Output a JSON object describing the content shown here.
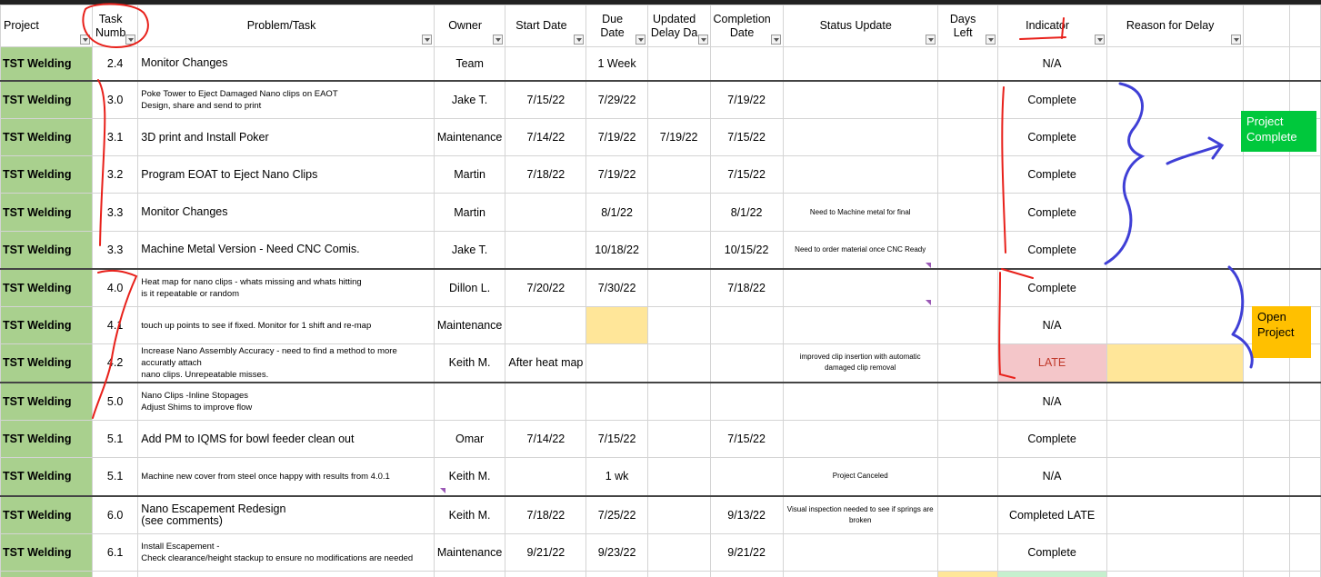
{
  "columns": {
    "project": "Project",
    "task": "Task Numb",
    "problem": "Problem/Task",
    "owner": "Owner",
    "start": "Start Date",
    "due": "Due Date",
    "updated": "Updated Delay Da",
    "completion": "Completion Date",
    "status": "Status Update",
    "days": "Days Left",
    "indicator": "Indicator",
    "reason": "Reason for Delay"
  },
  "rows": [
    {
      "project": "TST Welding",
      "task": "2.4",
      "problem": "Monitor Changes",
      "owner": "Team",
      "start": "",
      "due": "1 Week",
      "updated": "",
      "completion": "",
      "status": "",
      "days": "",
      "indicator": "N/A",
      "reason": ""
    },
    {
      "project": "TST Welding",
      "task": "3.0",
      "problem": "Poke Tower to Eject Damaged Nano clips on EAOT\nDesign, share and send to print",
      "owner": "Jake T.",
      "start": "7/15/22",
      "due": "7/29/22",
      "updated": "",
      "completion": "7/19/22",
      "status": "",
      "days": "",
      "indicator": "Complete",
      "reason": ""
    },
    {
      "project": "TST Welding",
      "task": "3.1",
      "problem": "3D print and Install Poker",
      "owner": "Maintenance",
      "start": "7/14/22",
      "due": "7/19/22",
      "updated": "7/19/22",
      "completion": "7/15/22",
      "status": "",
      "days": "",
      "indicator": "Complete",
      "reason": ""
    },
    {
      "project": "TST Welding",
      "task": "3.2",
      "problem": "Program EOAT to Eject Nano Clips",
      "owner": "Martin",
      "start": "7/18/22",
      "due": "7/19/22",
      "updated": "",
      "completion": "7/15/22",
      "status": "",
      "days": "",
      "indicator": "Complete",
      "reason": ""
    },
    {
      "project": "TST Welding",
      "task": "3.3",
      "problem": "Monitor Changes",
      "owner": "Martin",
      "start": "",
      "due": "8/1/22",
      "updated": "",
      "completion": "8/1/22",
      "status": "Need to Machine metal for final",
      "days": "",
      "indicator": "Complete",
      "reason": ""
    },
    {
      "project": "TST Welding",
      "task": "3.3",
      "problem": "Machine Metal Version - Need CNC Comis.",
      "owner": "Jake T.",
      "start": "",
      "due": "10/18/22",
      "updated": "",
      "completion": "10/15/22",
      "status": "Need to order material once CNC Ready",
      "days": "",
      "indicator": "Complete",
      "reason": ""
    },
    {
      "project": "TST Welding",
      "task": "4.0",
      "problem": "Heat map for nano clips - whats missing and whats hitting\nis it repeatable or random",
      "owner": "Dillon L.",
      "start": "7/20/22",
      "due": "7/30/22",
      "updated": "",
      "completion": "7/18/22",
      "status": "",
      "days": "",
      "indicator": "Complete",
      "reason": ""
    },
    {
      "project": "TST Welding",
      "task": "4.1",
      "problem": "touch up points to see if fixed. Monitor for 1 shift and re-map",
      "owner": "Maintenance",
      "start": "",
      "due": "",
      "updated": "",
      "completion": "",
      "status": "",
      "days": "",
      "indicator": "N/A",
      "reason": ""
    },
    {
      "project": "TST Welding",
      "task": "4.2",
      "problem": "Increase Nano Assembly Accuracy - need to find a method to more accuratly attach\nnano clips. Unrepeatable misses.",
      "owner": "Keith M.",
      "start": "After heat map",
      "due": "",
      "updated": "",
      "completion": "",
      "status": "improved clip insertion with automatic damaged clip removal",
      "days": "",
      "indicator": "LATE",
      "reason": ""
    },
    {
      "project": "TST Welding",
      "task": "5.0",
      "problem": "Nano Clips -Inline Stopages\nAdjust Shims to improve flow",
      "owner": "",
      "start": "",
      "due": "",
      "updated": "",
      "completion": "",
      "status": "",
      "days": "",
      "indicator": "N/A",
      "reason": ""
    },
    {
      "project": "TST Welding",
      "task": "5.1",
      "problem": "Add PM to IQMS for bowl feeder clean out",
      "owner": "Omar",
      "start": "7/14/22",
      "due": "7/15/22",
      "updated": "",
      "completion": "7/15/22",
      "status": "",
      "days": "",
      "indicator": "Complete",
      "reason": ""
    },
    {
      "project": "TST Welding",
      "task": "5.1",
      "problem": "Machine new cover from steel once happy with results from 4.0.1",
      "owner": "Keith M.",
      "start": "",
      "due": "1 wk",
      "updated": "",
      "completion": "",
      "status": "Project Canceled",
      "days": "",
      "indicator": "N/A",
      "reason": ""
    },
    {
      "project": "TST Welding",
      "task": "6.0",
      "problem": "Nano Escapement Redesign\n(see comments)",
      "owner": "Keith M.",
      "start": "7/18/22",
      "due": "7/25/22",
      "updated": "",
      "completion": "9/13/22",
      "status": "Visual inspection needed to see if springs are broken",
      "days": "",
      "indicator": "Completed LATE",
      "reason": ""
    },
    {
      "project": "TST Welding",
      "task": "6.1",
      "problem": "Install Escapement -\nCheck clearance/height stackup to ensure no modifications are needed",
      "owner": "Maintenance",
      "start": "9/21/22",
      "due": "9/23/22",
      "updated": "",
      "completion": "9/21/22",
      "status": "",
      "days": "",
      "indicator": "Complete",
      "reason": ""
    }
  ],
  "notes": {
    "complete": "Project Complete",
    "open": "Open Project"
  },
  "colors": {
    "project_fill": "#a9d08e",
    "late_fill": "#f4c6c9",
    "late_text": "#c0392b",
    "pending_fill": "#ffe699",
    "ok_fill": "#c6efce",
    "note_complete": "#00c83c",
    "note_open": "#ffc000",
    "ink_red": "#e8201a",
    "ink_blue": "#3f3fd6"
  }
}
